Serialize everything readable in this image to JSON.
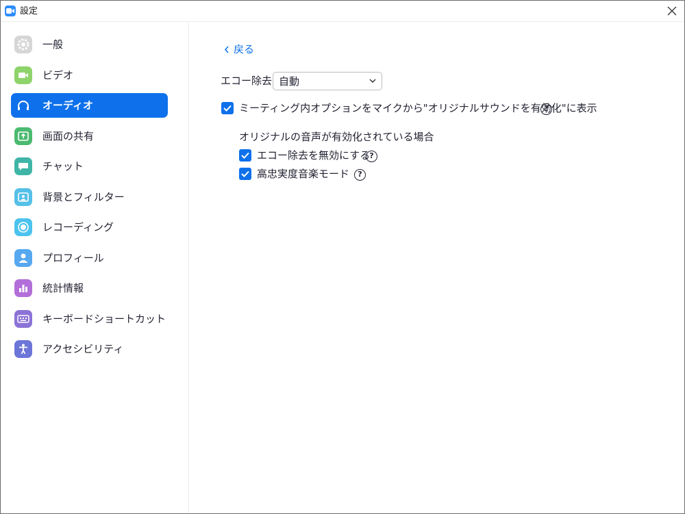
{
  "window": {
    "title": "設定",
    "app_icon": "zoom-camera-icon",
    "close_icon": "close-icon"
  },
  "sidebar": {
    "items": [
      {
        "label": "一般",
        "icon": "gear-icon",
        "color": "#d4d4d4",
        "active": false
      },
      {
        "label": "ビデオ",
        "icon": "video-camera-icon",
        "color": "#8fd36b",
        "active": false
      },
      {
        "label": "オーディオ",
        "icon": "headphones-icon",
        "color": "#0e71eb",
        "active": true
      },
      {
        "label": "画面の共有",
        "icon": "share-screen-icon",
        "color": "#4cba70",
        "active": false
      },
      {
        "label": "チャット",
        "icon": "chat-bubble-icon",
        "color": "#3fb5a7",
        "active": false
      },
      {
        "label": "背景とフィルター",
        "icon": "background-icon",
        "color": "#55c0e8",
        "active": false
      },
      {
        "label": "レコーディング",
        "icon": "record-icon",
        "color": "#4cc3ee",
        "active": false
      },
      {
        "label": "プロフィール",
        "icon": "person-icon",
        "color": "#56a8f0",
        "active": false
      },
      {
        "label": "統計情報",
        "icon": "bar-chart-icon",
        "color": "#b36fd9",
        "active": false
      },
      {
        "label": "キーボードショートカット",
        "icon": "keyboard-icon",
        "color": "#8b73d6",
        "active": false
      },
      {
        "label": "アクセシビリティ",
        "icon": "accessibility-icon",
        "color": "#6c75d8",
        "active": false
      }
    ]
  },
  "main": {
    "back_label": "戻る",
    "echo": {
      "label": "エコー除去",
      "selected": "自動"
    },
    "show_option": {
      "label": "ミーティング内オプションをマイクから\"オリジナルサウンドを有効化\"に表示",
      "checked": true
    },
    "original_sound": {
      "heading": "オリジナルの音声が有効化されている場合",
      "disable_echo": {
        "label": "エコー除去を無効にする",
        "checked": true
      },
      "hifi_music": {
        "label": "高忠実度音楽モード",
        "checked": true
      }
    },
    "help_glyph": "?"
  },
  "colors": {
    "accent": "#0e71eb",
    "text": "#232333"
  }
}
